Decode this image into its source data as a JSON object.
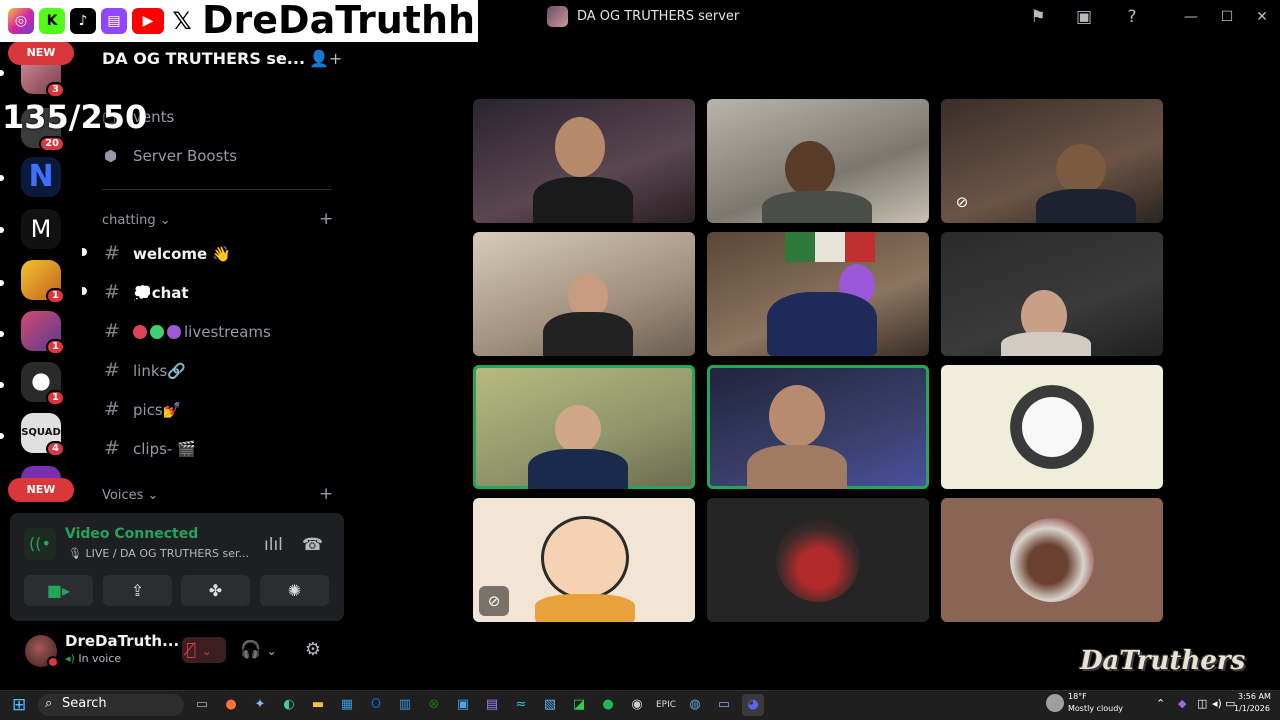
{
  "window": {
    "title": "DA OG TRUTHERS server"
  },
  "overlay": {
    "streamer_name": "DreDaTruthhh",
    "member_count": "135/250",
    "watermark": "DaTruthers",
    "socials": [
      "instagram-icon",
      "kick-icon",
      "tiktok-icon",
      "twitch-icon",
      "youtube-icon",
      "x-icon"
    ]
  },
  "rail": {
    "new_label_top": "NEW",
    "new_label_bottom": "NEW",
    "servers": [
      {
        "icon": "server-pink-avatar",
        "badge": "3"
      },
      {
        "icon": "server-20",
        "badge": "20"
      },
      {
        "icon": "server-n-logo",
        "badge": ""
      },
      {
        "icon": "server-m-logo",
        "badge": ""
      },
      {
        "icon": "server-goku",
        "badge": "1"
      },
      {
        "icon": "server-anime",
        "badge": "1"
      },
      {
        "icon": "server-bearded",
        "badge": "1"
      },
      {
        "icon": "server-squad",
        "badge": "4"
      }
    ]
  },
  "sidebar": {
    "server_name": "DA OG TRUTHERS se...",
    "events_label": "vents",
    "boosts_label": "Server Boosts",
    "categories": {
      "chatting": "chatting",
      "voices": "Voices"
    },
    "channels": [
      {
        "name": "welcome",
        "emoji": "👋",
        "unread": true
      },
      {
        "name": "chat",
        "emoji": "💭",
        "unread": true
      },
      {
        "name": "livestreams",
        "emoji": "",
        "unread": false
      },
      {
        "name": "links",
        "emoji": "🔗",
        "unread": false
      },
      {
        "name": "pics",
        "emoji": "💅",
        "unread": false
      },
      {
        "name": "clips-",
        "emoji": "🎬",
        "unread": false
      }
    ]
  },
  "voice": {
    "status": "Video Connected",
    "channel": "LIVE / DA OG TRUTHERS ser..."
  },
  "user": {
    "name": "DreDaTruth...",
    "status": "In voice"
  },
  "taskbar": {
    "search_label": "Search",
    "weather_temp": "18°F",
    "weather_desc": "Mostly cloudy",
    "time": "3:56 AM",
    "date": "1/1/2026"
  },
  "colors": {
    "accent_green": "#23a55a",
    "danger_red": "#da373c"
  }
}
